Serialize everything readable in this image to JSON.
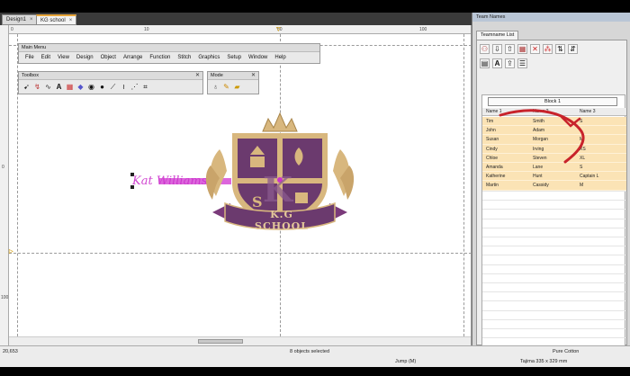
{
  "document_tabs": [
    {
      "label": "Design1",
      "close": "×"
    },
    {
      "label": "KG school",
      "close": "×"
    }
  ],
  "rulers": {
    "top": [
      "0",
      "10",
      "50",
      "100"
    ],
    "left": [
      "0",
      "100"
    ]
  },
  "main_menu": {
    "title": "Main Menu",
    "items": [
      "File",
      "Edit",
      "View",
      "Design",
      "Object",
      "Arrange",
      "Function",
      "Stitch",
      "Graphics",
      "Setup",
      "Window",
      "Help"
    ]
  },
  "toolbox": {
    "title": "Toolbox",
    "icons": [
      "select-arrow-icon",
      "reshape-icon",
      "stitch-icon",
      "text-icon",
      "fill-pattern-icon",
      "diamond-icon",
      "circle-icon",
      "dark-circle-icon",
      "line-icon",
      "zigzag-icon",
      "node-icon",
      "crosshair-icon"
    ]
  },
  "mode": {
    "title": "Mode",
    "icons": [
      "hot-air-balloon-icon",
      "paint-tools-icon",
      "folder-icon"
    ]
  },
  "canvas": {
    "text_object": "Kat Williams"
  },
  "logo": {
    "banner_text": "K.G SCHOOL",
    "letter": "K",
    "colors": {
      "purple": "#6b3a6e",
      "gold": "#d8b77e",
      "magenta": "#cc33cc"
    }
  },
  "dock": {
    "title": "Team Names",
    "tab": "Teamname List",
    "selector": "Block 1",
    "columns": [
      "Name 1",
      "Name 2",
      "Name 3"
    ],
    "rows": [
      [
        "Tim",
        "Smith",
        "S"
      ],
      [
        "John",
        "Adam",
        "L"
      ],
      [
        "Susan",
        "Morgan",
        "M"
      ],
      [
        "Cindy",
        "Irving",
        "XS"
      ],
      [
        "Chloe",
        "Steven",
        "XL"
      ],
      [
        "Amanda",
        "Lane",
        "S"
      ],
      [
        "Katherine",
        "Hunt",
        "Captain L"
      ],
      [
        "Martin",
        "Cassidy",
        "M"
      ]
    ],
    "row_color": "#fbe3b5"
  },
  "status": {
    "coords": "20,653",
    "selection": "8 objects selected",
    "fabric": "Pure Cotton",
    "stitch_mode": "Jump (M)",
    "machine": "Tajima 335 x 329 mm"
  }
}
